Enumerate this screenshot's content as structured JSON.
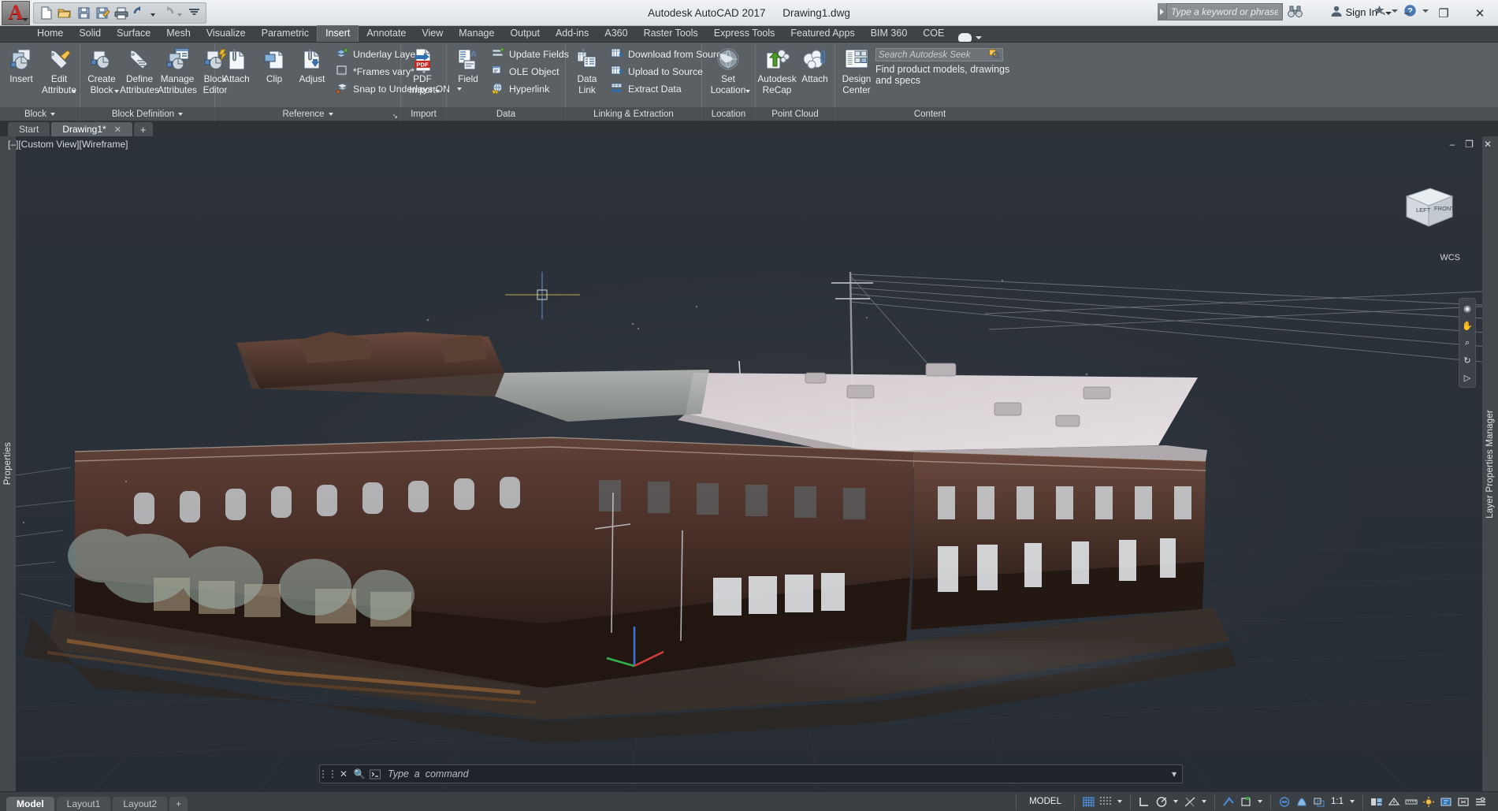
{
  "window": {
    "app_title": "Autodesk AutoCAD 2017",
    "file_title": "Drawing1.dwg",
    "minimize_label": "–",
    "maximize_label": "❐",
    "close_label": "✕"
  },
  "quick_access": {
    "items": [
      {
        "name": "new-icon",
        "label": "New"
      },
      {
        "name": "open-icon",
        "label": "Open"
      },
      {
        "name": "save-icon",
        "label": "Save"
      },
      {
        "name": "save-as-icon",
        "label": "Save As"
      },
      {
        "name": "plot-icon",
        "label": "Plot"
      },
      {
        "name": "undo-icon",
        "label": "Undo"
      },
      {
        "name": "redo-icon",
        "label": "Redo"
      },
      {
        "name": "customize-icon",
        "label": "Customize Quick Access Toolbar"
      }
    ]
  },
  "infocenter": {
    "search_placeholder": "Type a keyword or phrase",
    "sign_in_label": "Sign In",
    "binoculars_icon": "binoculars-icon",
    "app_store_icon": "app-store-icon",
    "help_icon": "help-icon",
    "settings_icon": "settings-icon"
  },
  "ribbon_tabs": [
    {
      "label": "Home",
      "active": false
    },
    {
      "label": "Solid",
      "active": false
    },
    {
      "label": "Surface",
      "active": false
    },
    {
      "label": "Mesh",
      "active": false
    },
    {
      "label": "Visualize",
      "active": false
    },
    {
      "label": "Parametric",
      "active": false
    },
    {
      "label": "Insert",
      "active": true
    },
    {
      "label": "Annotate",
      "active": false
    },
    {
      "label": "View",
      "active": false
    },
    {
      "label": "Manage",
      "active": false
    },
    {
      "label": "Output",
      "active": false
    },
    {
      "label": "Add-ins",
      "active": false
    },
    {
      "label": "A360",
      "active": false
    },
    {
      "label": "Raster Tools",
      "active": false
    },
    {
      "label": "Express Tools",
      "active": false
    },
    {
      "label": "Featured Apps",
      "active": false
    },
    {
      "label": "BIM 360",
      "active": false
    },
    {
      "label": "COE",
      "active": false
    }
  ],
  "ribbon": {
    "panels": [
      {
        "name": "block",
        "label": "Block",
        "has_dropdown": true,
        "big_buttons": [
          {
            "label_line1": "Insert",
            "label_line2": "",
            "icon": "insert-block-icon",
            "has_caret": false
          },
          {
            "label_line1": "Edit",
            "label_line2": "Attribute",
            "icon": "edit-attribute-icon",
            "has_caret": true
          }
        ]
      },
      {
        "name": "block-definition",
        "label": "Block Definition",
        "has_dropdown": true,
        "big_buttons": [
          {
            "label_line1": "Create",
            "label_line2": "Block",
            "icon": "create-block-icon",
            "has_caret": true
          },
          {
            "label_line1": "Define",
            "label_line2": "Attributes",
            "icon": "define-attributes-icon",
            "has_caret": false
          },
          {
            "label_line1": "Manage",
            "label_line2": "Attributes",
            "icon": "manage-attributes-icon",
            "has_caret": false
          },
          {
            "label_line1": "Block",
            "label_line2": "Editor",
            "icon": "block-editor-icon",
            "has_caret": false
          }
        ]
      },
      {
        "name": "reference",
        "label": "Reference",
        "has_dropdown": true,
        "has_dialog_launcher": true,
        "big_buttons": [
          {
            "label_line1": "Attach",
            "label_line2": "",
            "icon": "attach-icon",
            "has_caret": false
          },
          {
            "label_line1": "Clip",
            "label_line2": "",
            "icon": "clip-icon",
            "has_caret": false
          },
          {
            "label_line1": "Adjust",
            "label_line2": "",
            "icon": "adjust-icon",
            "has_caret": false
          }
        ],
        "small_buttons": [
          {
            "label": "Underlay Layers",
            "icon": "underlay-layers-icon",
            "has_caret": false
          },
          {
            "label": "*Frames vary*",
            "icon": "frames-vary-icon",
            "has_caret": true
          },
          {
            "label": "Snap to Underlays ON",
            "icon": "snap-to-underlays-icon",
            "has_caret": true
          }
        ]
      },
      {
        "name": "import",
        "label": "Import",
        "has_dropdown": false,
        "big_buttons": [
          {
            "label_line1": "PDF",
            "label_line2": "Import",
            "icon": "pdf-import-icon",
            "has_caret": true
          }
        ]
      },
      {
        "name": "data",
        "label": "Data",
        "has_dropdown": false,
        "big_buttons": [
          {
            "label_line1": "Field",
            "label_line2": "",
            "icon": "field-icon",
            "has_caret": false
          }
        ],
        "small_buttons": [
          {
            "label": "Update Fields",
            "icon": "update-fields-icon",
            "has_caret": false
          },
          {
            "label": "OLE Object",
            "icon": "ole-object-icon",
            "has_caret": false
          },
          {
            "label": "Hyperlink",
            "icon": "hyperlink-icon",
            "has_caret": false
          }
        ]
      },
      {
        "name": "linking-extraction",
        "label": "Linking & Extraction",
        "has_dropdown": false,
        "big_buttons": [
          {
            "label_line1": "Data",
            "label_line2": "Link",
            "icon": "data-link-icon",
            "has_caret": false
          }
        ],
        "small_buttons": [
          {
            "label": "Download from Source",
            "icon": "download-from-source-icon",
            "has_caret": false
          },
          {
            "label": "Upload to Source",
            "icon": "upload-to-source-icon",
            "has_caret": false
          },
          {
            "label": "Extract  Data",
            "icon": "extract-data-icon",
            "has_caret": false
          }
        ]
      },
      {
        "name": "location",
        "label": "Location",
        "has_dropdown": false,
        "big_buttons": [
          {
            "label_line1": "Set",
            "label_line2": "Location",
            "icon": "set-location-globe-icon",
            "has_caret": true
          }
        ]
      },
      {
        "name": "point-cloud",
        "label": "Point Cloud",
        "has_dropdown": false,
        "big_buttons": [
          {
            "label_line1": "Autodesk",
            "label_line2": "ReCap",
            "icon": "autodesk-recap-icon",
            "has_caret": false
          },
          {
            "label_line1": "Attach",
            "label_line2": "",
            "icon": "attach-point-cloud-icon",
            "has_caret": false
          }
        ]
      },
      {
        "name": "content",
        "label": "Content",
        "has_dropdown": false,
        "big_buttons": [
          {
            "label_line1": "Design",
            "label_line2": "Center",
            "icon": "design-center-icon",
            "has_caret": false
          }
        ],
        "seek": {
          "placeholder": "Search Autodesk Seek",
          "hint": "Find product models, drawings and specs",
          "search_icon": "seek-search-icon"
        }
      }
    ]
  },
  "doc_tabs": [
    {
      "label": "Start",
      "active": false,
      "closable": false
    },
    {
      "label": "Drawing1*",
      "active": true,
      "closable": true
    },
    {
      "label": "+",
      "active": false,
      "closable": false
    }
  ],
  "viewport": {
    "label": "[–][Custom View][Wireframe]",
    "controls": [
      "–",
      "❐",
      "✕"
    ],
    "wcs_label": "WCS",
    "cube_faces": {
      "left": "LEFT",
      "front": "FRONT"
    },
    "left_panel_label": "Properties",
    "right_panel_label": "Layer Properties Manager"
  },
  "command_line": {
    "placeholder": "Type  a  command",
    "close_icon": "close-icon",
    "search_icon": "command-search-icon",
    "prompt_icon": "command-prompt-icon",
    "expand_icon": "command-expand-icon"
  },
  "layout_tabs": [
    {
      "label": "Model",
      "active": true
    },
    {
      "label": "Layout1",
      "active": false
    },
    {
      "label": "Layout2",
      "active": false
    },
    {
      "label": "+",
      "active": false
    }
  ],
  "status_bar": {
    "model_label": "MODEL",
    "scale_label": "1:1",
    "groups": [
      {
        "name": "space-toggle",
        "items": [
          {
            "name": "model-space-button",
            "label": "MODEL"
          }
        ]
      },
      {
        "name": "display-grid",
        "items": [
          {
            "name": "grid-display-icon",
            "label": "Display drawing grid"
          },
          {
            "name": "snap-mode-icon",
            "label": "Snap mode"
          },
          {
            "name": "snap-dropdown-caret",
            "label": "Snap settings"
          }
        ]
      },
      {
        "name": "ortho-polar",
        "items": [
          {
            "name": "ortho-mode-icon",
            "label": "Ortho mode"
          },
          {
            "name": "polar-tracking-icon",
            "label": "Polar tracking"
          },
          {
            "name": "polar-dropdown-caret",
            "label": "Polar settings"
          },
          {
            "name": "object-snap-tracking-icon",
            "label": "Object snap tracking"
          },
          {
            "name": "osnap-tracking-caret",
            "label": "Snap tracking settings"
          }
        ]
      },
      {
        "name": "osnap",
        "items": [
          {
            "name": "object-snap-icon",
            "label": "Object snap"
          },
          {
            "name": "dynamic-ucs-icon",
            "label": "Dynamic UCS"
          },
          {
            "name": "osnap-caret",
            "label": "Object snap settings"
          }
        ]
      },
      {
        "name": "annotation",
        "items": [
          {
            "name": "lineweight-icon",
            "label": "Show lineweight"
          },
          {
            "name": "transparency-icon",
            "label": "Transparency"
          },
          {
            "name": "selection-cycling-icon",
            "label": "Selection cycling"
          },
          {
            "name": "annotation-scale-label",
            "label": "1:1"
          },
          {
            "name": "annotation-scale-caret",
            "label": "Annotation scale list"
          }
        ]
      },
      {
        "name": "workspace",
        "items": [
          {
            "name": "workspace-switching-icon",
            "label": "Workspace switching"
          },
          {
            "name": "annotation-monitor-icon",
            "label": "Annotation monitor"
          },
          {
            "name": "units-icon",
            "label": "Units"
          },
          {
            "name": "isolate-objects-icon",
            "label": "Isolate objects"
          },
          {
            "name": "hardware-acceleration-icon",
            "label": "Hardware acceleration"
          },
          {
            "name": "clean-screen-icon",
            "label": "Clean screen"
          },
          {
            "name": "customization-icon",
            "label": "Customization"
          }
        ]
      }
    ]
  },
  "colors": {
    "titlebar_top": "#f1f3f5",
    "ribbon_bg": "#5b6064",
    "ribbon_tab_bg": "#3f4346",
    "canvas_bg": "#2b3138",
    "accent_red": "#c62828",
    "accent_blue": "#2f6fb5",
    "status_bg": "#3b4044",
    "text_light": "#eceff1"
  }
}
